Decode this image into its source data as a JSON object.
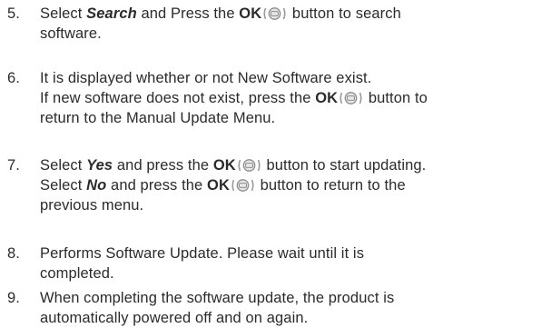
{
  "icon": "ok-remote-button-icon",
  "steps": [
    {
      "number": "5.",
      "lines": [
        [
          {
            "t": "Select ",
            "s": "n"
          },
          {
            "t": "Search",
            "s": "bi"
          },
          {
            "t": " and Press the ",
            "s": "n"
          },
          {
            "t": "OK",
            "s": "b"
          },
          {
            "t": "",
            "s": "icon"
          },
          {
            "t": " button to search",
            "s": "n"
          }
        ],
        [
          {
            "t": "software.",
            "s": "n"
          }
        ]
      ]
    },
    {
      "number": "6.",
      "lines": [
        [
          {
            "t": "It is displayed whether or not New Software exist.",
            "s": "n"
          }
        ],
        [
          {
            "t": "If new software does not exist, press the ",
            "s": "n"
          },
          {
            "t": "OK",
            "s": "b"
          },
          {
            "t": "",
            "s": "icon"
          },
          {
            "t": " button to",
            "s": "n"
          }
        ],
        [
          {
            "t": "return to the Manual Update Menu.",
            "s": "n"
          }
        ]
      ]
    },
    {
      "number": "7.",
      "lines": [
        [
          {
            "t": "Select ",
            "s": "n"
          },
          {
            "t": "Yes",
            "s": "bi"
          },
          {
            "t": " and press the ",
            "s": "n"
          },
          {
            "t": "OK",
            "s": "b"
          },
          {
            "t": "",
            "s": "icon"
          },
          {
            "t": " button to start updating.",
            "s": "n"
          }
        ],
        [
          {
            "t": "Select ",
            "s": "n"
          },
          {
            "t": "No",
            "s": "bi"
          },
          {
            "t": " and press the ",
            "s": "n"
          },
          {
            "t": "OK",
            "s": "b"
          },
          {
            "t": "",
            "s": "icon"
          },
          {
            "t": " button to return to the",
            "s": "n"
          }
        ],
        [
          {
            "t": "previous menu.",
            "s": "n"
          }
        ]
      ]
    },
    {
      "number": "8.",
      "lines": [
        [
          {
            "t": "Performs Software Update. Please wait until it is",
            "s": "n"
          }
        ],
        [
          {
            "t": "completed.",
            "s": "n"
          }
        ]
      ]
    },
    {
      "number": "9.",
      "lines": [
        [
          {
            "t": "When completing the software update, the product is",
            "s": "n"
          }
        ],
        [
          {
            "t": "automatically powered off and on again.",
            "s": "n"
          }
        ]
      ]
    }
  ]
}
